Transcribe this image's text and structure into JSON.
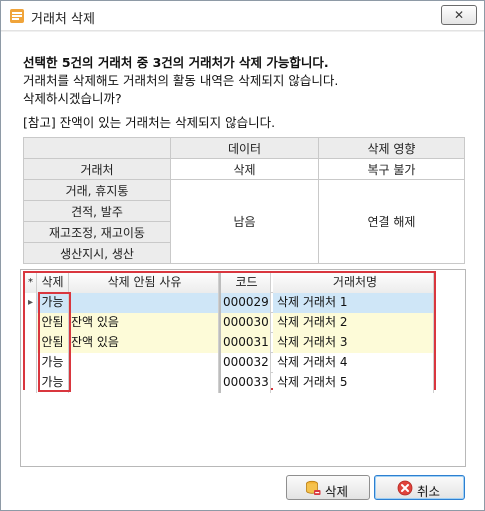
{
  "window": {
    "title": "거래처 삭제",
    "close_label": "✕"
  },
  "message": {
    "headline": "선택한 5건의 거래처 중 3건의 거래처가 삭제 가능합니다.",
    "line1": "거래처를 삭제해도 거래처의 활동 내역은 삭제되지 않습니다.",
    "line2": "삭제하시겠습니까?",
    "note": "[참고] 잔액이 있는 거래처는 삭제되지 않습니다."
  },
  "impact_table": {
    "header_data": "데이터",
    "header_effect": "삭제 영향",
    "row_vendor": "거래처",
    "vendor_data": "삭제",
    "vendor_effect": "복구 불가",
    "rows": [
      "거래, 휴지통",
      "견적, 발주",
      "재고조정, 재고이동",
      "생산지시, 생산"
    ],
    "other_data": "남음",
    "other_effect": "연결 해제"
  },
  "grid": {
    "columns": {
      "marker": "*",
      "delete": "삭제",
      "reason": "삭제 안됨 사유",
      "code": "코드",
      "name": "거래처명"
    },
    "rows": [
      {
        "delete": "가능",
        "reason": "",
        "code": "000029",
        "name": "삭제 거래처 1"
      },
      {
        "delete": "안됨",
        "reason": "잔액 있음",
        "code": "000030",
        "name": "삭제 거래처 2"
      },
      {
        "delete": "안됨",
        "reason": "잔액 있음",
        "code": "000031",
        "name": "삭제 거래처 3"
      },
      {
        "delete": "가능",
        "reason": "",
        "code": "000032",
        "name": "삭제 거래처 4"
      },
      {
        "delete": "가능",
        "reason": "",
        "code": "000033",
        "name": "삭제 거래처 5"
      }
    ],
    "current_row_marker": "▸"
  },
  "buttons": {
    "delete_label": "삭제",
    "cancel_label": "취소"
  },
  "colors": {
    "highlight_border": "#d9363e",
    "selected_row": "#cfe6f7",
    "blocked_row": "#fdfbd8"
  }
}
